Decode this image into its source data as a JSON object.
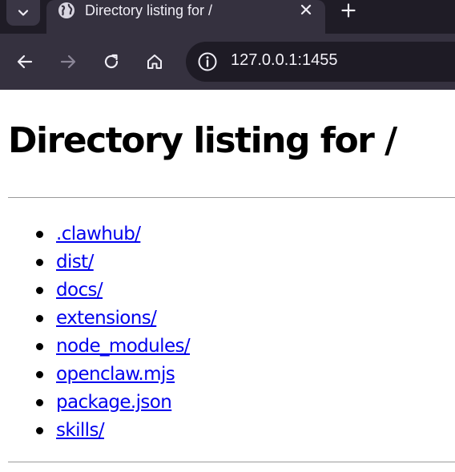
{
  "browser": {
    "tab": {
      "title": "Directory listing for /",
      "favicon_icon": "globe-icon",
      "close_icon": "close-icon"
    },
    "new_tab_icon": "plus-icon",
    "tab_list_icon": "chevron-down-icon",
    "toolbar": {
      "back_icon": "arrow-left-icon",
      "forward_icon": "arrow-right-icon",
      "reload_icon": "reload-icon",
      "home_icon": "home-icon",
      "site_info_icon": "info-icon",
      "url": "127.0.0.1:1455"
    },
    "colors": {
      "tabbar_bg": "#1f1c26",
      "toolbar_bg": "#35313f",
      "urlbar_bg": "#1e1b25",
      "link": "#0000ee"
    }
  },
  "page": {
    "heading": "Directory listing for /",
    "entries": [
      ".clawhub/",
      "dist/",
      "docs/",
      "extensions/",
      "node_modules/",
      "openclaw.mjs",
      "package.json",
      "skills/"
    ]
  }
}
